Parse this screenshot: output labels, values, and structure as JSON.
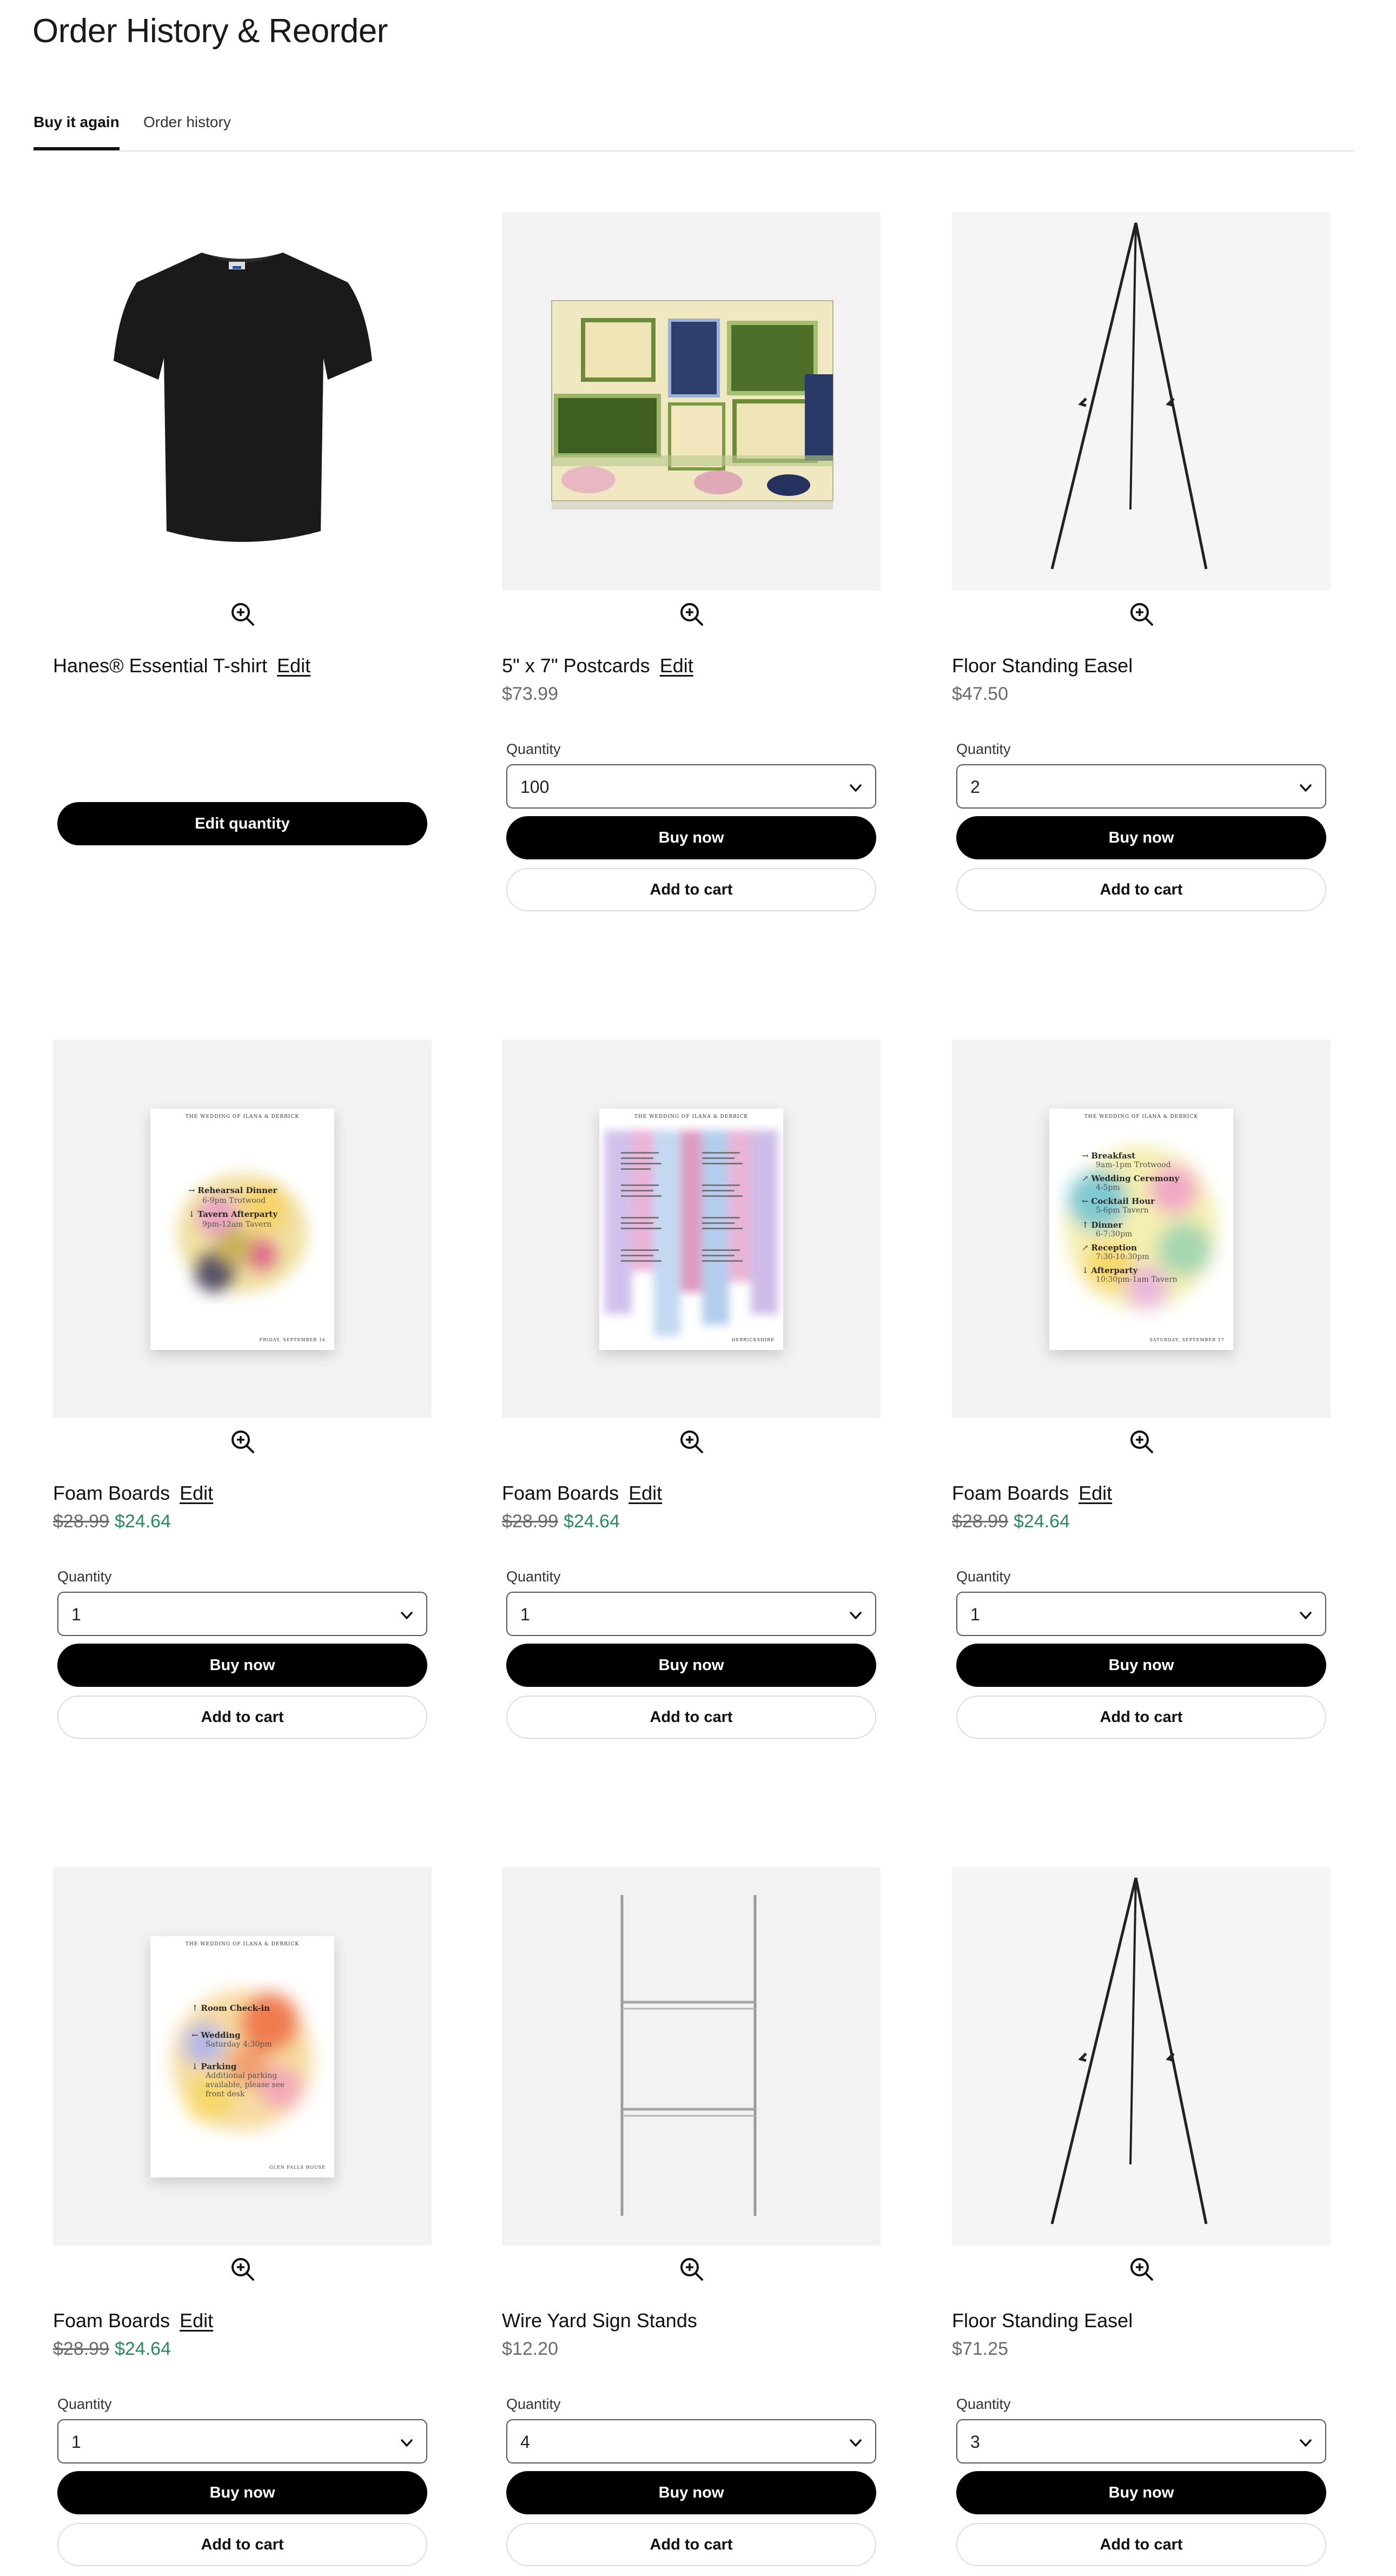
{
  "page": {
    "title": "Order History & Reorder"
  },
  "tabs": [
    {
      "label": "Buy it again",
      "active": true
    },
    {
      "label": "Order history",
      "active": false
    }
  ],
  "common": {
    "edit_label": "Edit",
    "quantity_label": "Quantity",
    "buy_now_label": "Buy now",
    "add_to_cart_label": "Add to cart",
    "edit_quantity_label": "Edit quantity"
  },
  "products": [
    {
      "name": "Hanes® Essential T-shirt",
      "editable": true,
      "price": "",
      "quantity": "",
      "image": "black-tshirt"
    },
    {
      "name": "5\" x 7\" Postcards",
      "editable": true,
      "price": "$73.99",
      "quantity": "100",
      "image": "postcards"
    },
    {
      "name": "Floor Standing Easel",
      "editable": false,
      "price": "$47.50",
      "quantity": "2",
      "image": "easel"
    },
    {
      "name": "Foam Boards",
      "editable": true,
      "original_price": "$28.99",
      "sale_price": "$24.64",
      "quantity": "1",
      "image": "wedding-poster-rehearsal"
    },
    {
      "name": "Foam Boards",
      "editable": true,
      "original_price": "$28.99",
      "sale_price": "$24.64",
      "quantity": "1",
      "image": "wedding-poster-seating"
    },
    {
      "name": "Foam Boards",
      "editable": true,
      "original_price": "$28.99",
      "sale_price": "$24.64",
      "quantity": "1",
      "image": "wedding-poster-schedule"
    },
    {
      "name": "Foam Boards",
      "editable": true,
      "original_price": "$28.99",
      "sale_price": "$24.64",
      "quantity": "1",
      "image": "wedding-poster-welcome"
    },
    {
      "name": "Wire Yard Sign Stands",
      "editable": false,
      "price": "$12.20",
      "quantity": "4",
      "image": "wire-stand"
    },
    {
      "name": "Floor Standing Easel",
      "editable": false,
      "price": "$71.25",
      "quantity": "3",
      "image": "easel"
    }
  ],
  "posters": {
    "header": "THE WEDDING OF ILANA & DERRICK",
    "rehearsal": {
      "footer": "FRIDAY, SEPTEMBER 16",
      "lines": [
        {
          "arrow": "→",
          "title": "Rehearsal Dinner",
          "sub": "6-9pm Trotwood"
        },
        {
          "arrow": "↓",
          "title": "Tavern Afterparty",
          "sub": "9pm-12am Tavern"
        }
      ]
    },
    "schedule": {
      "footer": "SATURDAY, SEPTEMBER 17",
      "lines": [
        {
          "arrow": "→",
          "title": "Breakfast",
          "sub": "9am-1pm Trotwood"
        },
        {
          "arrow": "↗",
          "title": "Wedding Ceremony",
          "sub": "4-5pm"
        },
        {
          "arrow": "←",
          "title": "Cocktail Hour",
          "sub": "5-6pm Tavern"
        },
        {
          "arrow": "↑",
          "title": "Dinner",
          "sub": "6-7:30pm"
        },
        {
          "arrow": "↗",
          "title": "Reception",
          "sub": "7:30-10:30pm"
        },
        {
          "arrow": "↓",
          "title": "Afterparty",
          "sub": "10:30pm-1am Tavern"
        }
      ]
    },
    "welcome": {
      "footer": "GLEN FALLS HOUSE",
      "lines": [
        {
          "arrow": "↑",
          "title": "Room Check-in",
          "sub": ""
        },
        {
          "arrow": "←",
          "title": "Wedding",
          "sub": "Saturday 4:30pm"
        },
        {
          "arrow": "↓",
          "title": "Parking",
          "sub": "Additional parking available, please see front desk"
        }
      ]
    },
    "seating_footer": "DERRICKSHIRE"
  },
  "colors": {
    "accent_sale": "#2b8a5a",
    "button_primary": "#000000",
    "muted_text": "#6b6b6b",
    "image_background": "#f2f2f2"
  }
}
